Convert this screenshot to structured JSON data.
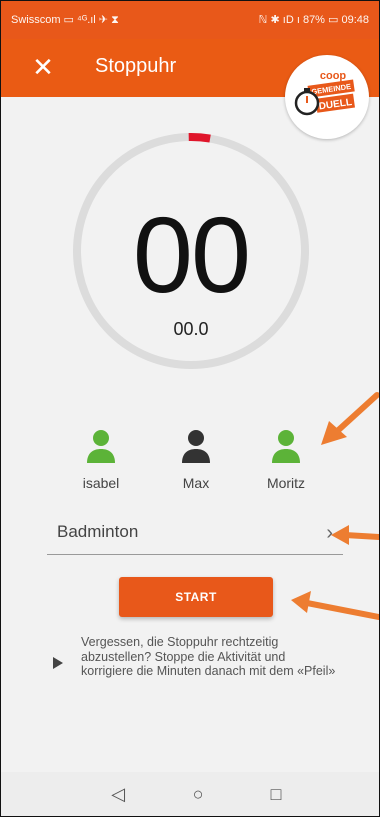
{
  "status_bar": {
    "carrier": "Swisscom ▭ ⁴ᴳ.ıl ✈ ⧗",
    "indicators": "ℕ ✱ ıD ı 87% ▭ 09:48"
  },
  "app_bar": {
    "title": "Stoppuhr",
    "close_icon": "✕"
  },
  "logo": {
    "line1": "coop",
    "line2": "GEMEINDE",
    "line3": "DUELL"
  },
  "timer": {
    "minutes": "00",
    "seconds": "00.0",
    "progress": 0.03
  },
  "participants": [
    {
      "name": "isabel",
      "color": "#5cb338"
    },
    {
      "name": "Max",
      "color": "#333333"
    },
    {
      "name": "Moritz",
      "color": "#5cb338"
    }
  ],
  "activity": {
    "label": "Badminton",
    "chevron": "›"
  },
  "start_button": {
    "label": "START"
  },
  "hint": {
    "text": "Vergessen, die Stoppuhr rechtzeitig abzustellen? Stoppe die Aktivität und korrigiere die Minuten danach mit dem «Pfeil»"
  },
  "nav": {
    "back": "◁",
    "home": "○",
    "recents": "□"
  },
  "colors": {
    "brand": "#ea5b14",
    "accent_red": "#e0162b",
    "ring": "#dcdcdc",
    "annotation_arrow": "#ed7d31"
  }
}
